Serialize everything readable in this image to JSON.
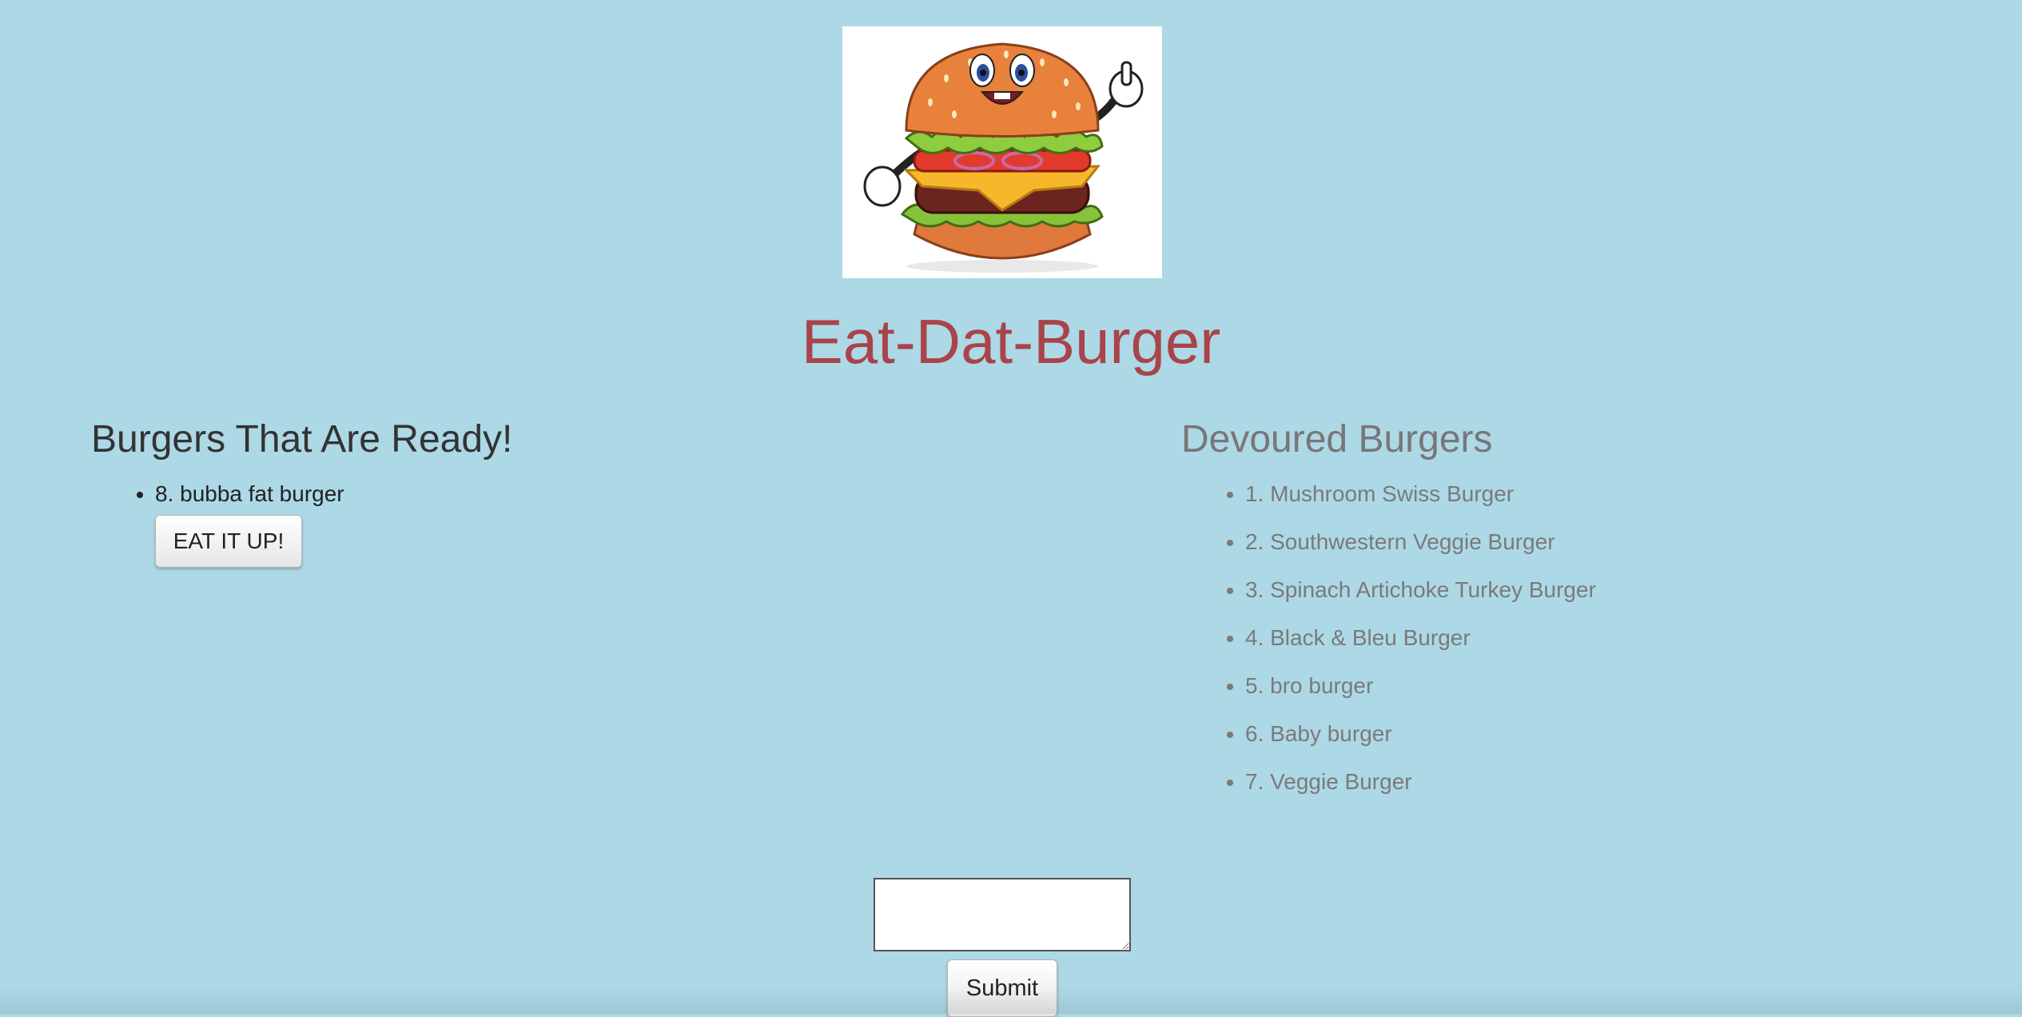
{
  "header": {
    "logo_icon": "burger-mascot-icon",
    "title": "Eat-Dat-Burger"
  },
  "ready": {
    "title": "Burgers That Are Ready!",
    "items": [
      {
        "label": "8. bubba fat burger",
        "button_label": "EAT IT UP!"
      }
    ]
  },
  "devoured": {
    "title": "Devoured Burgers",
    "items": [
      "1. Mushroom Swiss Burger",
      "2. Southwestern Veggie Burger",
      "3. Spinach Artichoke Turkey Burger",
      "4. Black & Bleu Burger",
      "5. bro burger",
      "6. Baby burger",
      "7. Veggie Burger"
    ]
  },
  "form": {
    "input_value": "",
    "submit_label": "Submit"
  },
  "colors": {
    "background": "#add8e6",
    "title": "#a9444a",
    "ready_text": "#333333",
    "devoured_text": "#777777"
  }
}
